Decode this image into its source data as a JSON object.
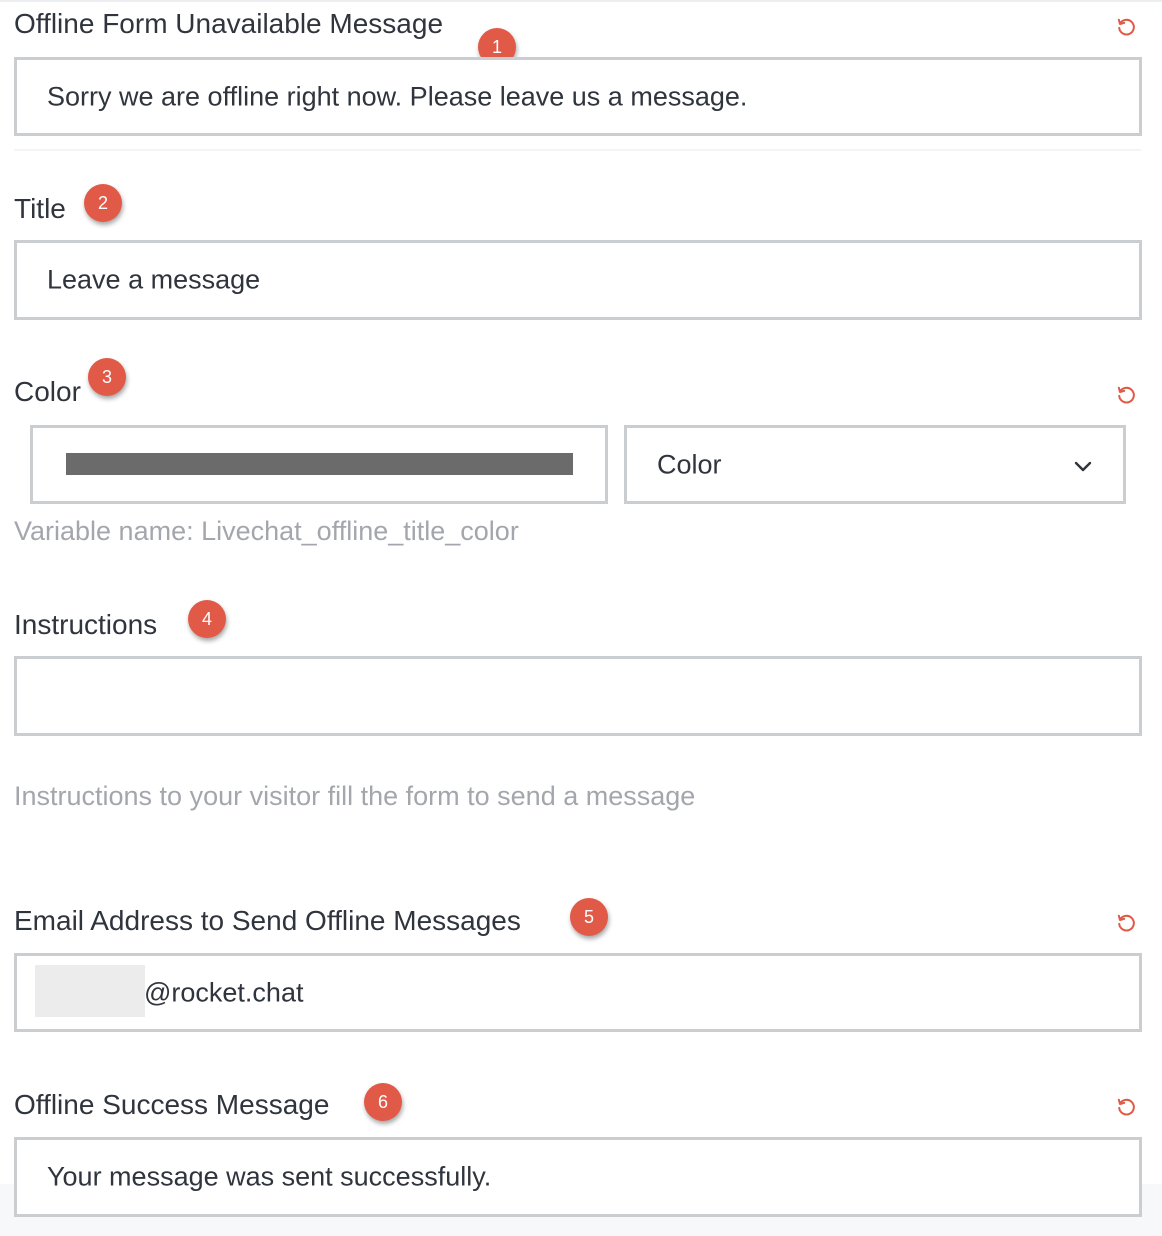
{
  "colors": {
    "badge": "#e05a47",
    "reset_icon": "#e05a47",
    "swatch": "#6b6b6b"
  },
  "sections": {
    "offline_unavailable": {
      "label": "Offline Form Unavailable Message",
      "badge": "1",
      "value": "Sorry we are offline right now. Please leave us a message."
    },
    "title": {
      "label": "Title",
      "badge": "2",
      "value": "Leave a message"
    },
    "color": {
      "label": "Color",
      "badge": "3",
      "select_value": "Color",
      "hint": "Variable name: Livechat_offline_title_color"
    },
    "instructions": {
      "label": "Instructions",
      "badge": "4",
      "value": "",
      "hint": "Instructions to your visitor fill the form to send a message"
    },
    "email": {
      "label": "Email Address to Send Offline Messages",
      "badge": "5",
      "value": "@rocket.chat"
    },
    "success": {
      "label": "Offline Success Message",
      "badge": "6",
      "value": "Your message was sent successfully."
    }
  }
}
